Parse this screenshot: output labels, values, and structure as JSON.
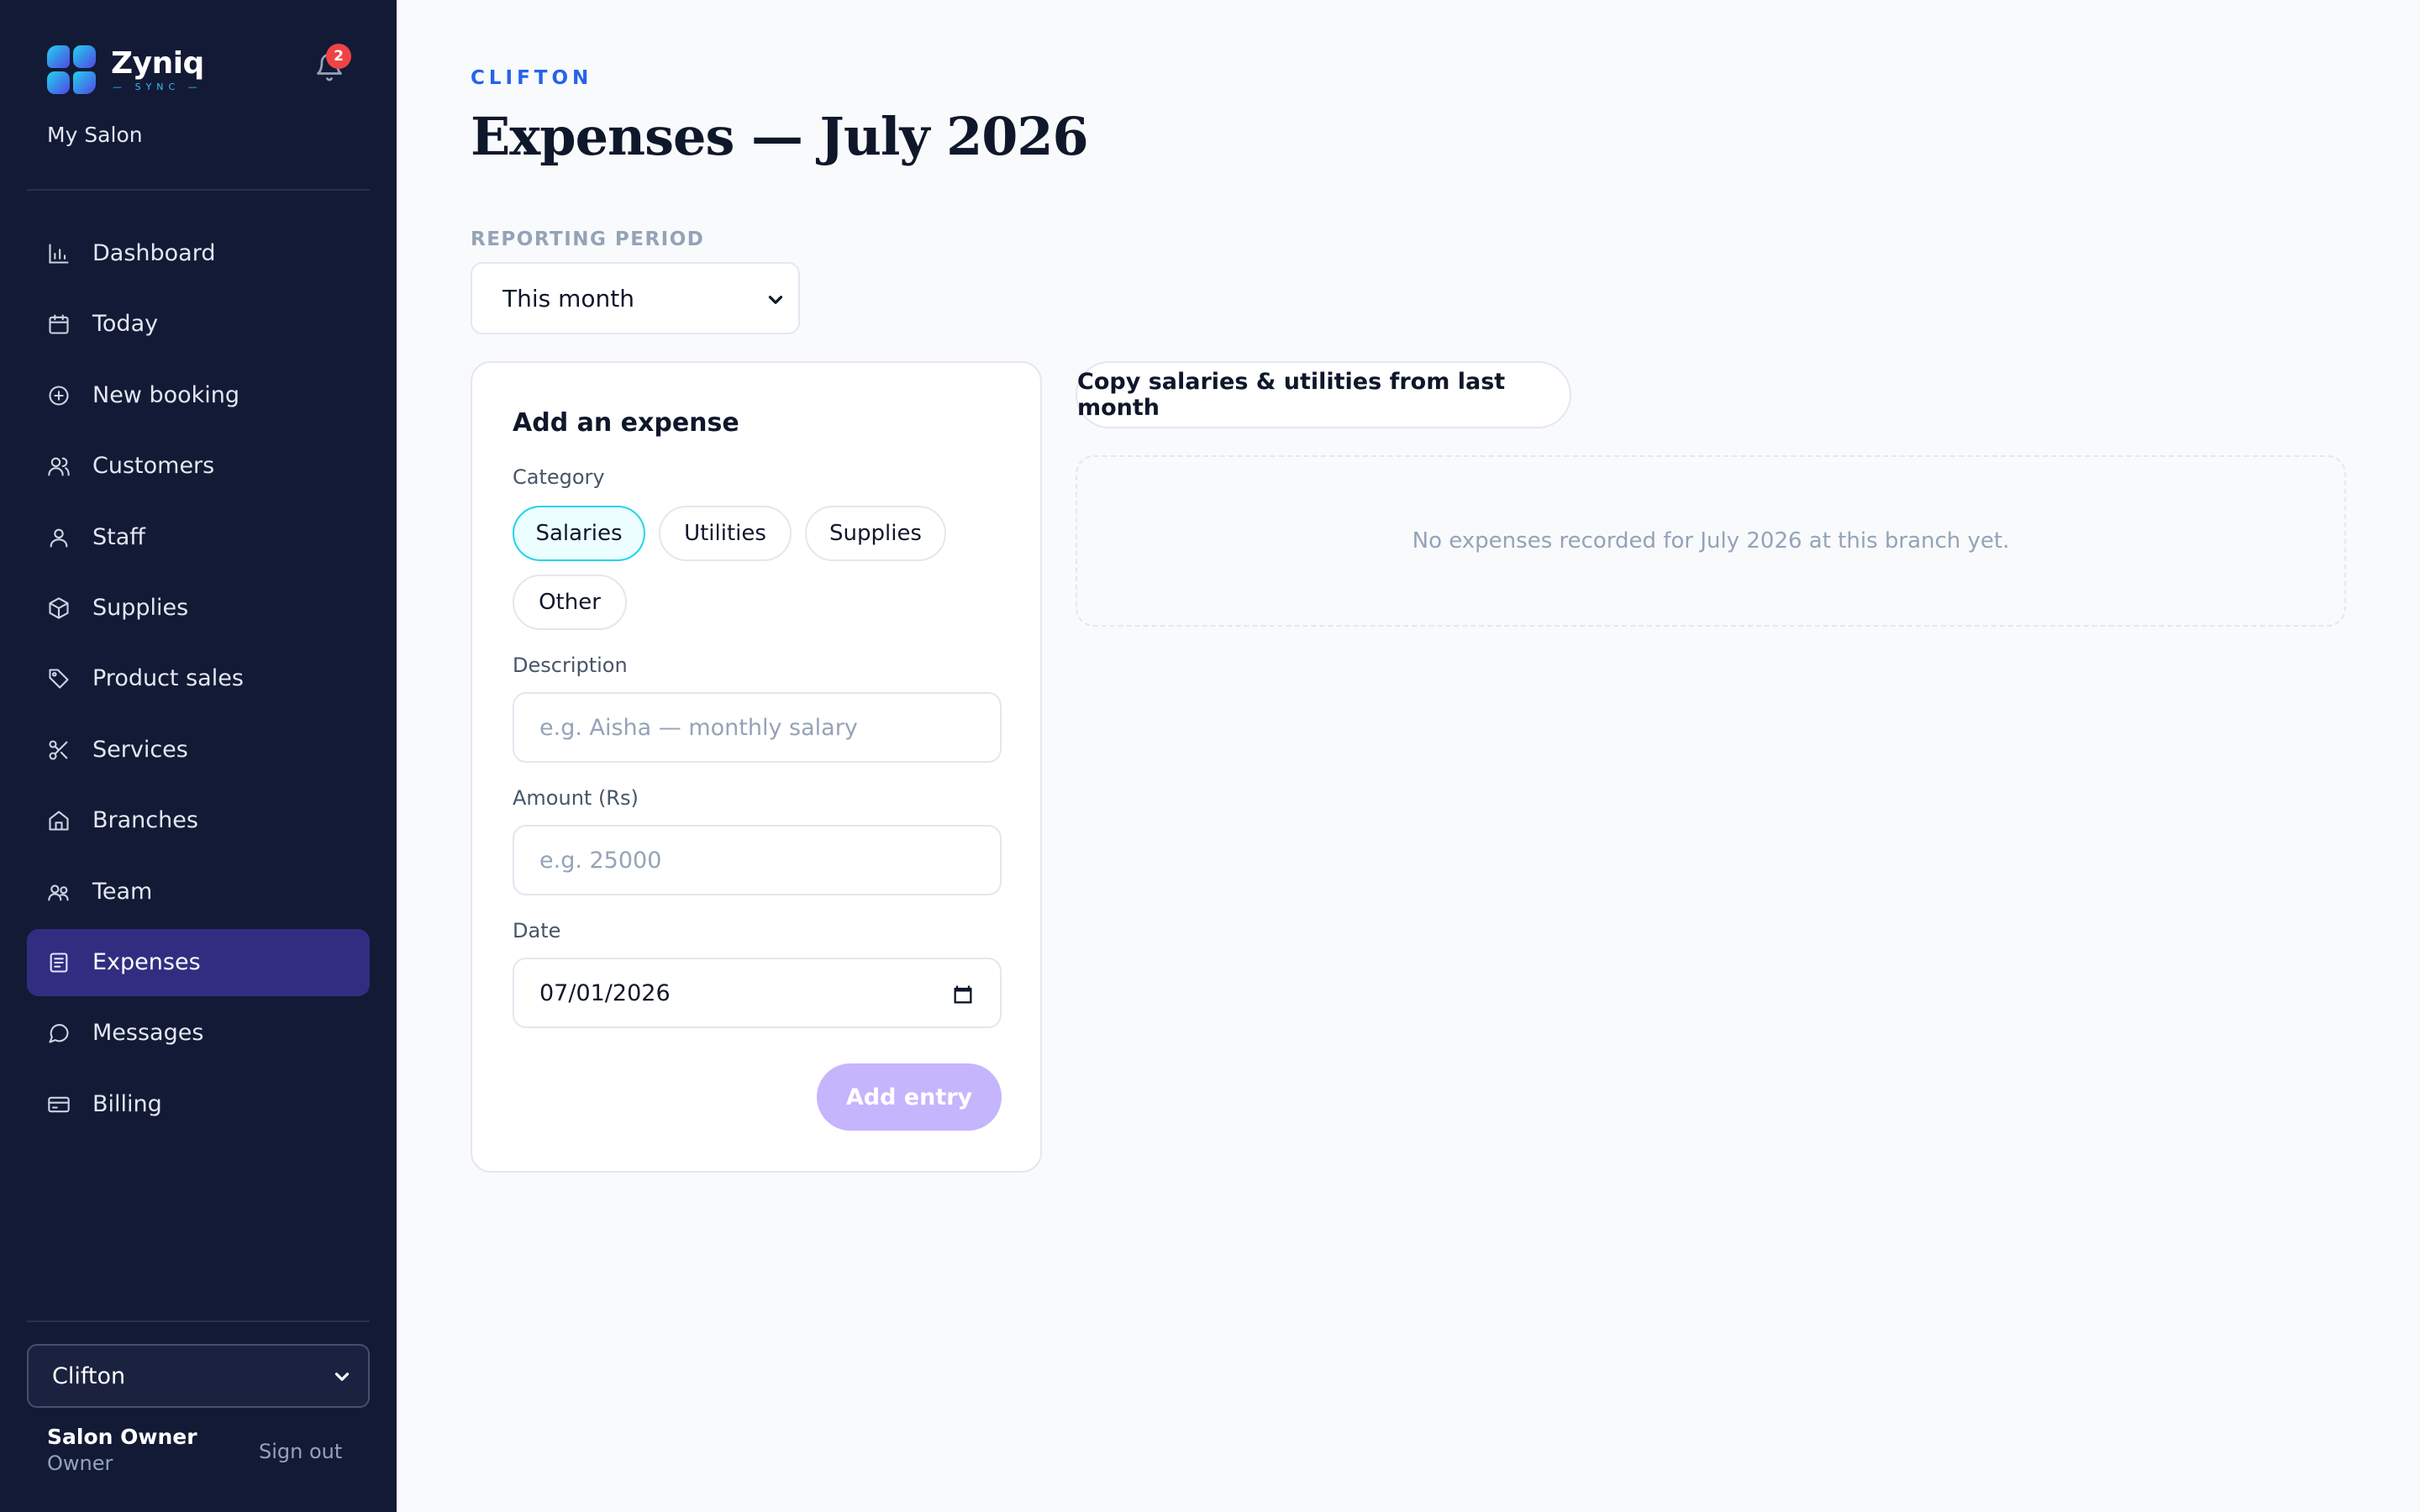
{
  "app": {
    "name": "Zyniq",
    "tagline": "SYNC",
    "salon_name": "My Salon",
    "notification_count": "2"
  },
  "sidebar": {
    "items": [
      {
        "label": "Dashboard",
        "icon": "bar-chart-icon"
      },
      {
        "label": "Today",
        "icon": "calendar-icon"
      },
      {
        "label": "New booking",
        "icon": "plus-circle-icon"
      },
      {
        "label": "Customers",
        "icon": "users-icon"
      },
      {
        "label": "Staff",
        "icon": "user-icon"
      },
      {
        "label": "Supplies",
        "icon": "box-icon"
      },
      {
        "label": "Product sales",
        "icon": "tag-icon"
      },
      {
        "label": "Services",
        "icon": "scissors-icon"
      },
      {
        "label": "Branches",
        "icon": "home-icon"
      },
      {
        "label": "Team",
        "icon": "team-icon"
      },
      {
        "label": "Expenses",
        "icon": "receipt-icon",
        "active": true
      },
      {
        "label": "Messages",
        "icon": "message-icon"
      },
      {
        "label": "Billing",
        "icon": "credit-card-icon"
      }
    ],
    "branch_selected": "Clifton",
    "user": {
      "name": "Salon Owner",
      "role": "Owner"
    },
    "sign_out": "Sign out"
  },
  "main": {
    "eyebrow": "CLIFTON",
    "title": "Expenses — July 2026",
    "period_label": "REPORTING PERIOD",
    "period_selected": "This month",
    "form": {
      "title": "Add an expense",
      "category_label": "Category",
      "categories": [
        {
          "label": "Salaries",
          "selected": true
        },
        {
          "label": "Utilities",
          "selected": false
        },
        {
          "label": "Supplies",
          "selected": false
        },
        {
          "label": "Other",
          "selected": false
        }
      ],
      "description_label": "Description",
      "description_placeholder": "e.g. Aisha — monthly salary",
      "amount_label": "Amount (Rs)",
      "amount_placeholder": "e.g. 25000",
      "date_label": "Date",
      "date_value": "07/01/2026",
      "submit_label": "Add entry"
    },
    "copy_button": "Copy salaries & utilities from last month",
    "empty_message": "No expenses recorded for July 2026 at this branch yet."
  },
  "colors": {
    "sidebar_bg": "#131a36",
    "active_nav": "#312e81",
    "accent_blue": "#2563eb",
    "chip_selected_border": "#22d3ee",
    "submit_disabled": "#c4b5fd",
    "badge": "#ef4444"
  }
}
